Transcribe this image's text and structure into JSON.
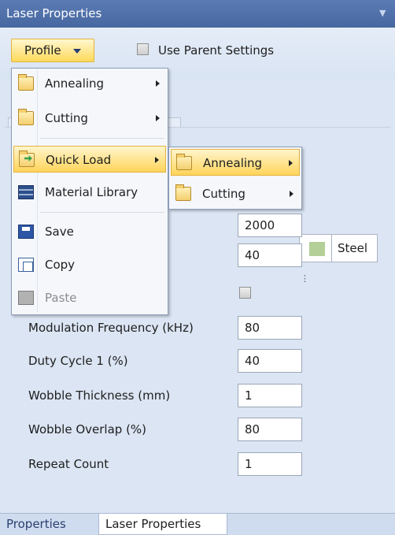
{
  "title": "Laser Properties",
  "toolbar": {
    "profile_label": "Profile",
    "use_parent_label": "Use Parent Settings"
  },
  "profile_menu": {
    "items": [
      {
        "label": "Annealing",
        "icon": "folder-icon",
        "has_submenu": true
      },
      {
        "label": "Cutting",
        "icon": "folder-icon",
        "has_submenu": true
      },
      {
        "label": "Quick Load",
        "icon": "quick-load-icon",
        "has_submenu": true,
        "highlighted": true
      },
      {
        "label": "Material Library",
        "icon": "material-library-icon",
        "has_submenu": false
      },
      {
        "label": "Save",
        "icon": "save-icon",
        "has_submenu": false
      },
      {
        "label": "Copy",
        "icon": "copy-icon",
        "has_submenu": false
      },
      {
        "label": "Paste",
        "icon": "paste-icon",
        "has_submenu": false,
        "disabled": true
      }
    ]
  },
  "quickload_submenu": {
    "items": [
      {
        "label": "Annealing",
        "icon": "folder-icon",
        "highlighted": true
      },
      {
        "label": "Cutting",
        "icon": "folder-icon"
      }
    ]
  },
  "material": {
    "swatch_color": "#b5cf98",
    "label": "Steel"
  },
  "properties": {
    "value_2000": "2000",
    "value_40a": "40",
    "rows": [
      {
        "label": "Modulation Frequency (kHz)",
        "value": "80"
      },
      {
        "label": "Duty Cycle 1 (%)",
        "value": "40"
      },
      {
        "label": "Wobble Thickness (mm)",
        "value": "1"
      },
      {
        "label": "Wobble Overlap (%)",
        "value": "80"
      },
      {
        "label": "Repeat Count",
        "value": "1"
      }
    ]
  },
  "bottom_tabs": [
    {
      "label": "Properties"
    },
    {
      "label": "Laser Properties",
      "active": true
    }
  ],
  "colors": {
    "title_bar": "#46679f",
    "highlight": "#ffd45a",
    "panel": "#dbe5f3"
  }
}
